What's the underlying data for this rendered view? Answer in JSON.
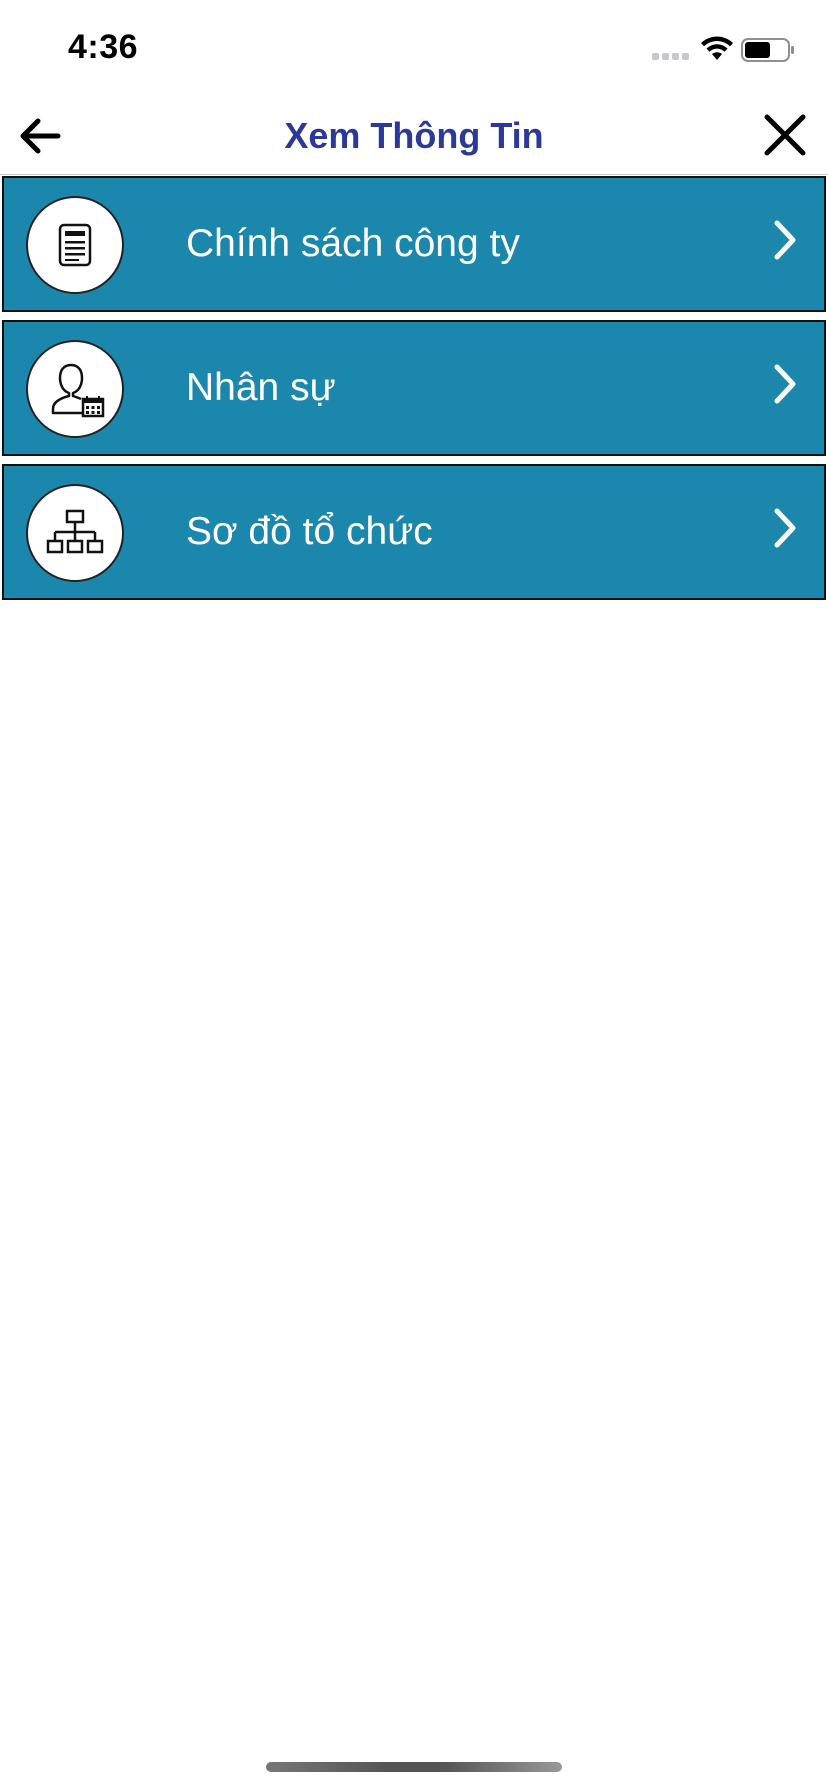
{
  "status_bar": {
    "time": "4:36"
  },
  "nav": {
    "title": "Xem Thông Tin",
    "back_icon": "arrow-left-icon",
    "close_icon": "close-icon",
    "title_color": "#2b3a9a"
  },
  "menu": {
    "background_color": "#1b87ad",
    "items": [
      {
        "label": "Chính sách công ty",
        "icon": "document-icon"
      },
      {
        "label": "Nhân sự",
        "icon": "person-calendar-icon"
      },
      {
        "label": "Sơ đồ tổ chức",
        "icon": "org-chart-icon"
      }
    ]
  }
}
